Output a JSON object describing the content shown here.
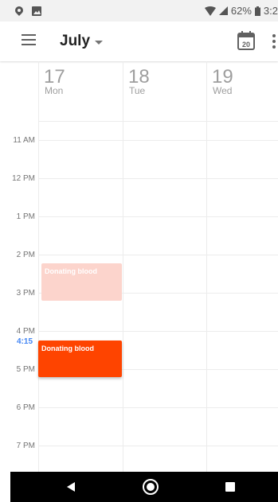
{
  "status": {
    "battery": "62%",
    "time": "3:2"
  },
  "appbar": {
    "month": "July",
    "today_icon_number": "20"
  },
  "days": [
    {
      "num": "17",
      "name": "Mon"
    },
    {
      "num": "18",
      "name": "Tue"
    },
    {
      "num": "19",
      "name": "Wed"
    }
  ],
  "hours": [
    "11 AM",
    "12 PM",
    "1 PM",
    "2 PM",
    "3 PM",
    "4 PM",
    "5 PM",
    "6 PM",
    "7 PM"
  ],
  "now_time": "4:15",
  "events": [
    {
      "title": "Donating blood",
      "state": "past"
    },
    {
      "title": "Donating blood",
      "state": "active"
    }
  ],
  "colors": {
    "event_active": "#fe4400",
    "event_past": "#fcd4cc",
    "now_marker": "#4285f4"
  }
}
